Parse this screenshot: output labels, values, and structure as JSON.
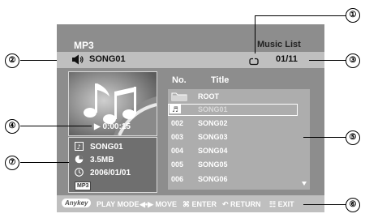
{
  "screen": {
    "mode": "MP3",
    "view": "Music List"
  },
  "songbar": {
    "current_song": "SONG01",
    "track_counter": "01/11",
    "speaker_icon": "speaker-icon",
    "repeat_icon": "repeat-icon"
  },
  "preview": {
    "playback_time": "▶ 0:00:15",
    "artwork_icon": "music-notes-icon"
  },
  "info": {
    "song_name": "SONG01",
    "file_size": "3.5MB",
    "date": "2006/01/01",
    "format_tag": "MP3"
  },
  "list": {
    "header_no": "No.",
    "header_title": "Title",
    "rows": [
      {
        "no": "",
        "title": "ROOT",
        "kind": "folder"
      },
      {
        "no": "♬",
        "title": "SONG01",
        "kind": "selected"
      },
      {
        "no": "002",
        "title": "SONG02",
        "kind": "file"
      },
      {
        "no": "003",
        "title": "SONG03",
        "kind": "file"
      },
      {
        "no": "004",
        "title": "SONG04",
        "kind": "file"
      },
      {
        "no": "005",
        "title": "SONG05",
        "kind": "file"
      },
      {
        "no": "006",
        "title": "SONG06",
        "kind": "file"
      }
    ]
  },
  "bottom": {
    "anykey": "Anykey",
    "play_mode": "PLAY MODE",
    "move": "◀•▶ MOVE",
    "enter": "⌘ ENTER",
    "return": "↶ RETURN",
    "exit": "☷ EXIT"
  },
  "callouts": [
    "①",
    "②",
    "③",
    "④",
    "⑤",
    "⑥",
    "⑦"
  ]
}
